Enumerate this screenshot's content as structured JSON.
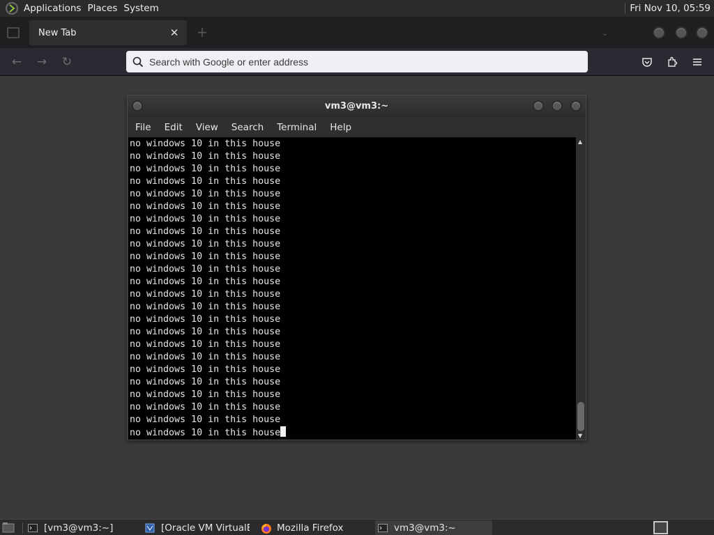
{
  "top_panel": {
    "menus": [
      "Applications",
      "Places",
      "System"
    ],
    "clock": "Fri Nov 10, 05:59"
  },
  "browser": {
    "tab": {
      "title": "New Tab",
      "close_label": "✕"
    },
    "new_tab_label": "+",
    "nav": {
      "back": "←",
      "forward": "→",
      "reload": "↻"
    },
    "url_bar": {
      "placeholder": "Search with Google or enter address",
      "value": ""
    }
  },
  "terminal": {
    "title": "vm3@vm3:~",
    "menu": [
      "File",
      "Edit",
      "View",
      "Search",
      "Terminal",
      "Help"
    ],
    "lines": [
      "no windows 10 in this house",
      "no windows 10 in this house",
      "no windows 10 in this house",
      "no windows 10 in this house",
      "no windows 10 in this house",
      "no windows 10 in this house",
      "no windows 10 in this house",
      "no windows 10 in this house",
      "no windows 10 in this house",
      "no windows 10 in this house",
      "no windows 10 in this house",
      "no windows 10 in this house",
      "no windows 10 in this house",
      "no windows 10 in this house",
      "no windows 10 in this house",
      "no windows 10 in this house",
      "no windows 10 in this house",
      "no windows 10 in this house",
      "no windows 10 in this house",
      "no windows 10 in this house",
      "no windows 10 in this house",
      "no windows 10 in this house",
      "no windows 10 in this house",
      "no windows 10 in this house"
    ]
  },
  "taskbar": {
    "tasks": [
      {
        "label": "[vm3@vm3:~]",
        "icon": "terminal-icon",
        "active": false
      },
      {
        "label": "[Oracle VM VirtualBo",
        "icon": "virtualbox-icon",
        "active": false
      },
      {
        "label": "Mozilla Firefox",
        "icon": "firefox-icon",
        "active": false
      },
      {
        "label": "vm3@vm3:~",
        "icon": "terminal-icon",
        "active": true
      }
    ]
  },
  "colors": {
    "panel_bg": "#2b2b2d",
    "desktop_bg": "#3a3a3c",
    "terminal_bg": "#000000",
    "terminal_fg": "#e6e6e6",
    "url_bar_bg": "#f0f0f4"
  }
}
